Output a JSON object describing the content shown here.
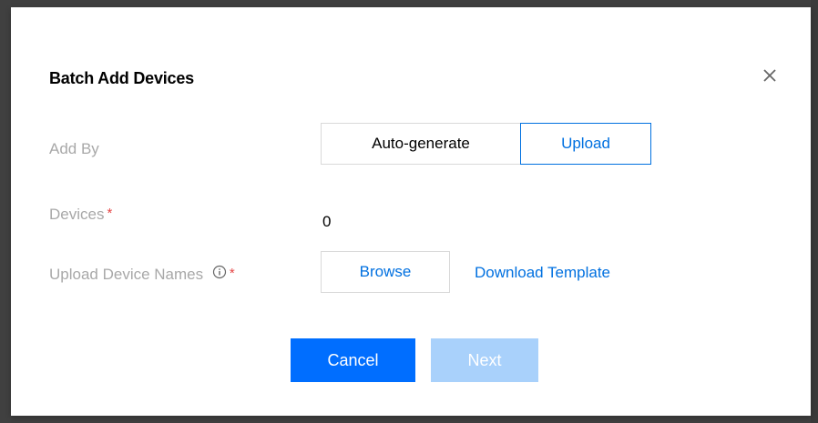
{
  "dialog": {
    "title": "Batch Add Devices",
    "close_icon": "close-icon"
  },
  "form": {
    "add_by": {
      "label": "Add By",
      "options": [
        "Auto-generate",
        "Upload"
      ],
      "selected": "Upload"
    },
    "devices": {
      "label": "Devices",
      "required_mark": "*",
      "value": "0"
    },
    "upload_device_names": {
      "label": "Upload Device Names",
      "info_icon": "info-icon",
      "required_mark": "*",
      "browse_label": "Browse",
      "download_template_label": "Download Template"
    }
  },
  "footer": {
    "cancel_label": "Cancel",
    "next_label": "Next",
    "next_disabled": true
  },
  "colors": {
    "primary": "#006eff",
    "link": "#0070e0",
    "disabled_primary": "#a9d1fb",
    "required": "#e54545",
    "label": "#a8a8a8"
  }
}
